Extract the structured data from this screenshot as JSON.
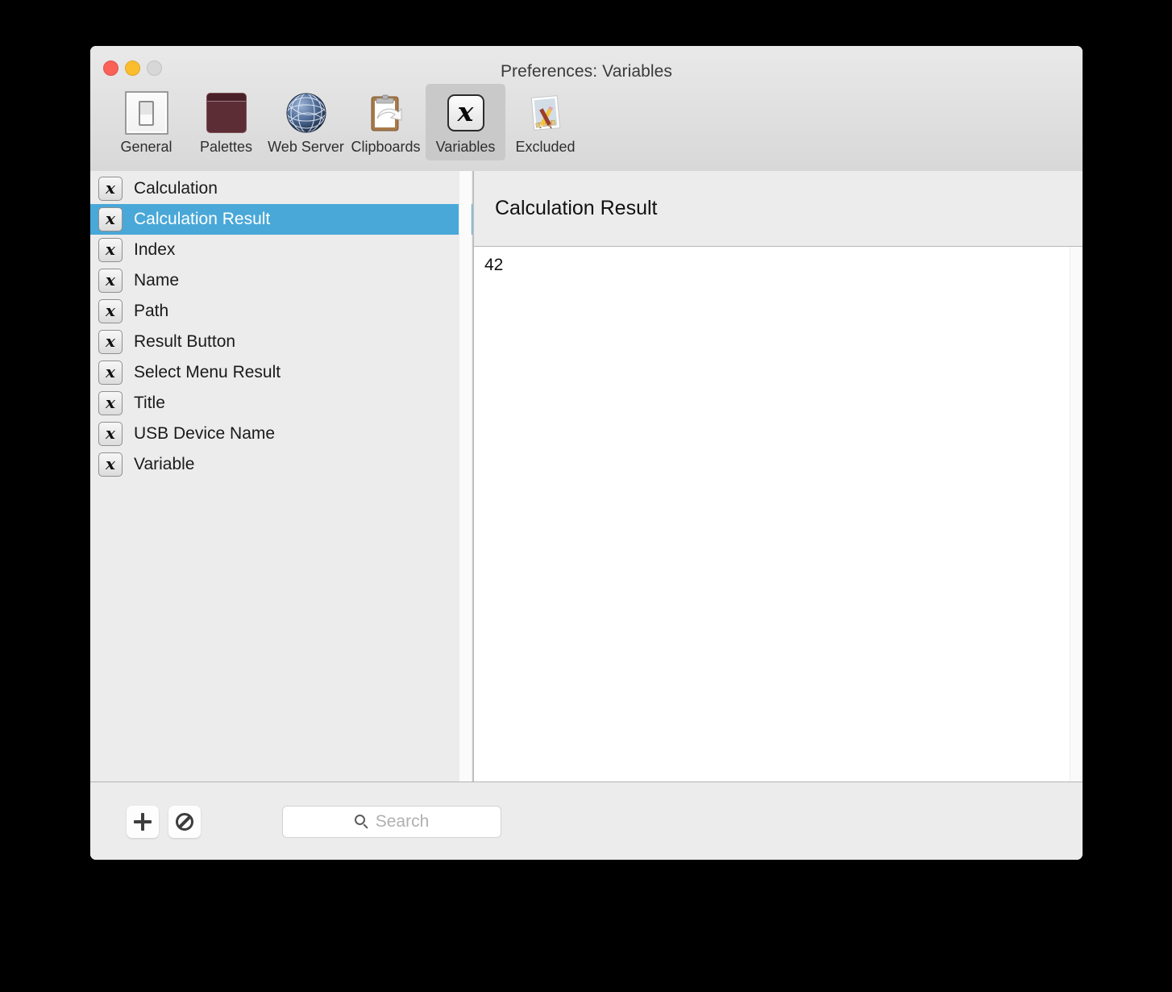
{
  "window": {
    "title": "Preferences: Variables",
    "traffic_lights": [
      {
        "name": "close",
        "color": "#fa6159"
      },
      {
        "name": "minimize",
        "color": "#fbbd2e"
      },
      {
        "name": "zoom",
        "color": "#d7d7d7"
      }
    ]
  },
  "toolbar": {
    "items": [
      {
        "label": "General",
        "icon": "light-switch-icon",
        "selected": false
      },
      {
        "label": "Palettes",
        "icon": "palette-panel-icon",
        "selected": false
      },
      {
        "label": "Web Server",
        "icon": "globe-icon",
        "selected": false
      },
      {
        "label": "Clipboards",
        "icon": "clipboard-arrow-icon",
        "selected": false
      },
      {
        "label": "Variables",
        "icon": "variable-x-icon",
        "selected": true
      },
      {
        "label": "Excluded",
        "icon": "document-tools-icon",
        "selected": false
      }
    ]
  },
  "variable_list": {
    "selected_index": 1,
    "row_icon": "variable-x-icon",
    "row_icon_glyph": "x",
    "items": [
      {
        "name": "Calculation"
      },
      {
        "name": "Calculation Result"
      },
      {
        "name": "Index"
      },
      {
        "name": "Name"
      },
      {
        "name": "Path"
      },
      {
        "name": "Result Button"
      },
      {
        "name": "Select Menu Result"
      },
      {
        "name": "Title"
      },
      {
        "name": "USB Device Name"
      },
      {
        "name": "Variable"
      }
    ]
  },
  "detail": {
    "title": "Calculation Result",
    "value": "42"
  },
  "bottom_bar": {
    "add_label": "+",
    "add_icon": "plus-icon",
    "disable_icon": "prohibit-icon",
    "search": {
      "placeholder": "Search",
      "value": "",
      "icon": "search-icon"
    }
  },
  "colors": {
    "selection_blue": "#49a8d8",
    "window_chrome": "#ececec",
    "toolbar_selected": "#c9c9c9"
  }
}
